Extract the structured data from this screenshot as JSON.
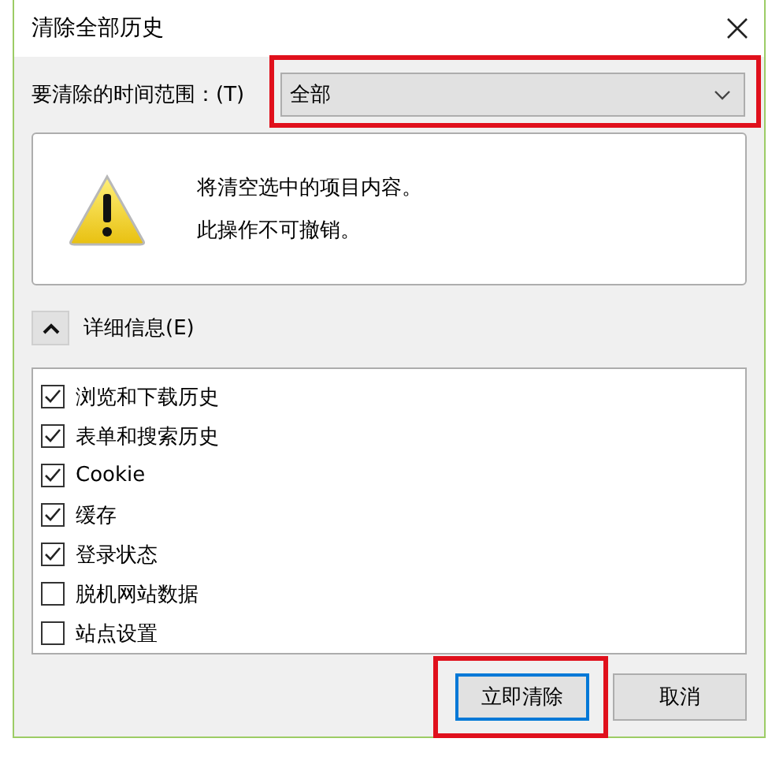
{
  "window": {
    "title": "清除全部历史"
  },
  "time_range": {
    "label": "要清除的时间范围：(T)",
    "value": "全部",
    "highlighted": true
  },
  "warning": {
    "lines": [
      "将清空选中的项目内容。",
      "此操作不可撤销。"
    ]
  },
  "details": {
    "label": "详细信息(E)",
    "expanded": true
  },
  "items": [
    {
      "label": "浏览和下载历史",
      "checked": true
    },
    {
      "label": "表单和搜索历史",
      "checked": true
    },
    {
      "label": "Cookie",
      "checked": true
    },
    {
      "label": "缓存",
      "checked": true
    },
    {
      "label": "登录状态",
      "checked": true
    },
    {
      "label": "脱机网站数据",
      "checked": false
    },
    {
      "label": "站点设置",
      "checked": false
    }
  ],
  "buttons": [
    {
      "label": "立即清除",
      "default": true,
      "highlighted": true
    },
    {
      "label": "取消",
      "default": false,
      "highlighted": false
    }
  ]
}
